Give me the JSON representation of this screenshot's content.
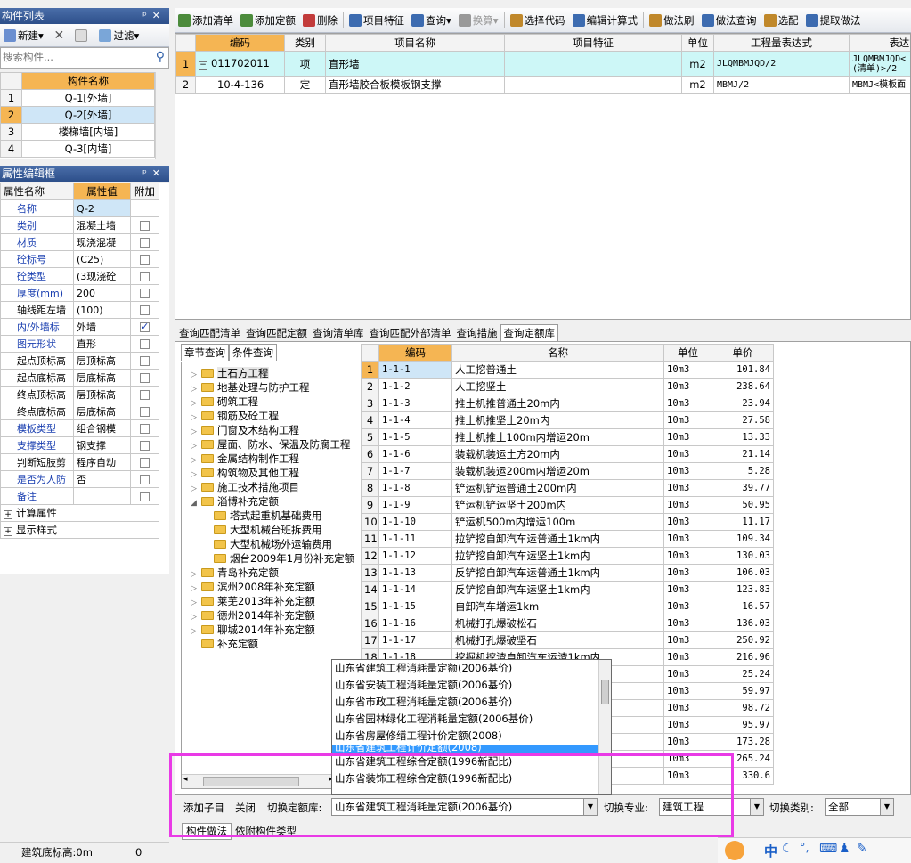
{
  "left_panel": {
    "title": "构件列表",
    "pin": "ᵖ",
    "close": "✕",
    "toolbar": {
      "new": "新建",
      "delete_icon": "✕",
      "filter": "过滤"
    },
    "search_placeholder": "搜索构件...",
    "header": "构件名称",
    "items": [
      {
        "n": "1",
        "name": "Q-1[外墙]"
      },
      {
        "n": "2",
        "name": "Q-2[外墙]"
      },
      {
        "n": "3",
        "name": "楼梯墙[内墙]"
      },
      {
        "n": "4",
        "name": "Q-3[内墙]"
      }
    ]
  },
  "props": {
    "title": "属性编辑框",
    "headers": [
      "属性名称",
      "属性值",
      "附加"
    ],
    "rows": [
      {
        "name": "名称",
        "value": "Q-2",
        "blue": true,
        "cb": ""
      },
      {
        "name": "类别",
        "value": "混凝土墙",
        "blue": true,
        "cb": "off"
      },
      {
        "name": "材质",
        "value": "现浇混凝",
        "blue": true,
        "cb": "off"
      },
      {
        "name": "砼标号",
        "value": "(C25)",
        "blue": true,
        "cb": "off"
      },
      {
        "name": "砼类型",
        "value": "(3现浇砼",
        "blue": true,
        "cb": "off"
      },
      {
        "name": "厚度(mm)",
        "value": "200",
        "blue": true,
        "cb": "off"
      },
      {
        "name": "轴线距左墙",
        "value": "(100)",
        "blue": false,
        "cb": "off"
      },
      {
        "name": "内/外墙标",
        "value": "外墙",
        "blue": true,
        "cb": "on"
      },
      {
        "name": "图元形状",
        "value": "直形",
        "blue": true,
        "cb": "off"
      },
      {
        "name": "起点顶标高",
        "value": "层顶标高",
        "blue": false,
        "cb": "off"
      },
      {
        "name": "起点底标高",
        "value": "层底标高",
        "blue": false,
        "cb": "off"
      },
      {
        "name": "终点顶标高",
        "value": "层顶标高",
        "blue": false,
        "cb": "off"
      },
      {
        "name": "终点底标高",
        "value": "层底标高",
        "blue": false,
        "cb": "off"
      },
      {
        "name": "模板类型",
        "value": "组合钢模",
        "blue": true,
        "cb": "off"
      },
      {
        "name": "支撑类型",
        "value": "钢支撑",
        "blue": true,
        "cb": "off"
      },
      {
        "name": "判断短肢剪",
        "value": "程序自动",
        "blue": false,
        "cb": "off"
      },
      {
        "name": "是否为人防",
        "value": "否",
        "blue": true,
        "cb": "off"
      },
      {
        "name": "备注",
        "value": "",
        "blue": true,
        "cb": "off"
      }
    ],
    "groups": [
      "计算属性",
      "显示样式"
    ]
  },
  "status": {
    "label": "建筑底标高:0m",
    "value": "0"
  },
  "main_toolbar": [
    "添加清单",
    "添加定额",
    "删除",
    "项目特征",
    "查询",
    "换算",
    "选择代码",
    "编辑计算式",
    "做法刷",
    "做法查询",
    "选配",
    "提取做法"
  ],
  "upper_table": {
    "headers": [
      "编码",
      "类别",
      "项目名称",
      "项目特征",
      "单位",
      "工程量表达式",
      "表达式"
    ],
    "rows": [
      {
        "n": "1",
        "code": "011702011",
        "type": "项",
        "name": "直形墙",
        "feat": "",
        "unit": "m2",
        "expr": "JLQMBMJQD/2",
        "expr2a": "JLQMBMJQD<",
        "expr2b": "(清单)>/2"
      },
      {
        "n": "2",
        "code": "10-4-136",
        "type": "定",
        "name": "直形墙胶合板模板钢支撑",
        "feat": "",
        "unit": "m2",
        "expr": "MBMJ/2",
        "expr2a": "MBMJ<模板面",
        "expr2b": ""
      }
    ]
  },
  "bottom_tabs": [
    "查询匹配清单",
    "查询匹配定额",
    "查询清单库",
    "查询匹配外部清单",
    "查询措施",
    "查询定额库"
  ],
  "sub_tabs": [
    "章节查询",
    "条件查询"
  ],
  "tree": [
    "土石方工程",
    "地基处理与防护工程",
    "砌筑工程",
    "钢筋及砼工程",
    "门窗及木结构工程",
    "屋面、防水、保温及防腐工程",
    "金属结构制作工程",
    "构筑物及其他工程",
    "施工技术措施项目",
    "淄博补充定额",
    "塔式起重机基础费用",
    "大型机械台班拆费用",
    "大型机械场外运输费用",
    "烟台2009年1月份补充定额",
    "青岛补充定额",
    "滨州2008年补充定额",
    "莱芜2013年补充定额",
    "德州2014年补充定额",
    "聊城2014年补充定额",
    "补充定额"
  ],
  "quota_table": {
    "headers": [
      "编码",
      "名称",
      "单位",
      "单价"
    ],
    "rows": [
      [
        "1",
        "1-1-1",
        "人工挖普通土",
        "10m3",
        "101.84"
      ],
      [
        "2",
        "1-1-2",
        "人工挖坚土",
        "10m3",
        "238.64"
      ],
      [
        "3",
        "1-1-3",
        "推土机推普通土20m内",
        "10m3",
        "23.94"
      ],
      [
        "4",
        "1-1-4",
        "推土机推坚土20m内",
        "10m3",
        "27.58"
      ],
      [
        "5",
        "1-1-5",
        "推土机推土100m内增运20m",
        "10m3",
        "13.33"
      ],
      [
        "6",
        "1-1-6",
        "装载机装运土方20m内",
        "10m3",
        "21.14"
      ],
      [
        "7",
        "1-1-7",
        "装载机装运200m内增运20m",
        "10m3",
        "5.28"
      ],
      [
        "8",
        "1-1-8",
        "铲运机铲运普通土200m内",
        "10m3",
        "39.77"
      ],
      [
        "9",
        "1-1-9",
        "铲运机铲运坚土200m内",
        "10m3",
        "50.95"
      ],
      [
        "10",
        "1-1-10",
        "铲运机500m内增运100m",
        "10m3",
        "11.17"
      ],
      [
        "11",
        "1-1-11",
        "拉铲挖自卸汽车运普通土1km内",
        "10m3",
        "109.34"
      ],
      [
        "12",
        "1-1-12",
        "拉铲挖自卸汽车运坚土1km内",
        "10m3",
        "130.03"
      ],
      [
        "13",
        "1-1-13",
        "反铲挖自卸汽车运普通土1km内",
        "10m3",
        "106.03"
      ],
      [
        "14",
        "1-1-14",
        "反铲挖自卸汽车运坚土1km内",
        "10m3",
        "123.83"
      ],
      [
        "15",
        "1-1-15",
        "自卸汽车增运1km",
        "10m3",
        "16.57"
      ],
      [
        "16",
        "1-1-16",
        "机械打孔爆破松石",
        "10m3",
        "136.03"
      ],
      [
        "17",
        "1-1-17",
        "机械打孔爆破坚石",
        "10m3",
        "250.92"
      ],
      [
        "18",
        "1-1-18",
        "挖掘机挖渣自卸汽车运渣1km内",
        "10m3",
        "216.96"
      ],
      [
        "",
        "",
        "",
        "10m3",
        "25.24"
      ],
      [
        "",
        "",
        "",
        "10m3",
        "59.97"
      ],
      [
        "",
        "",
        "",
        "10m3",
        "98.72"
      ],
      [
        "",
        "",
        "",
        "10m3",
        "95.97"
      ],
      [
        "",
        "",
        "",
        "10m3",
        "173.28"
      ],
      [
        "",
        "",
        "",
        "10m3",
        "265.24"
      ],
      [
        "",
        "",
        "",
        "10m3",
        "330.6"
      ]
    ]
  },
  "dropdown": [
    "山东省建筑工程消耗量定额(2006基价)",
    "山东省安装工程消耗量定额(2006基价)",
    "山东省市政工程消耗量定额(2006基价)",
    "山东省园林绿化工程消耗量定额(2006基价)",
    "山东省房屋修缮工程计价定额(2008)",
    "山东省建筑工程计价定额(2008)",
    "山东省建筑工程综合定额(1996新配比)",
    "山东省装饰工程综合定额(1996新配比)"
  ],
  "bottom_bar": {
    "add_child": "添加子目",
    "close": "关闭",
    "switch_lib": "切换定额库:",
    "lib_value": "山东省建筑工程消耗量定额(2006基价)",
    "switch_major": "切换专业:",
    "major_value": "建筑工程",
    "switch_type": "切换类别:",
    "type_value": "全部"
  },
  "page_tabs": [
    "构件做法",
    "依附构件类型"
  ],
  "ime": "中"
}
